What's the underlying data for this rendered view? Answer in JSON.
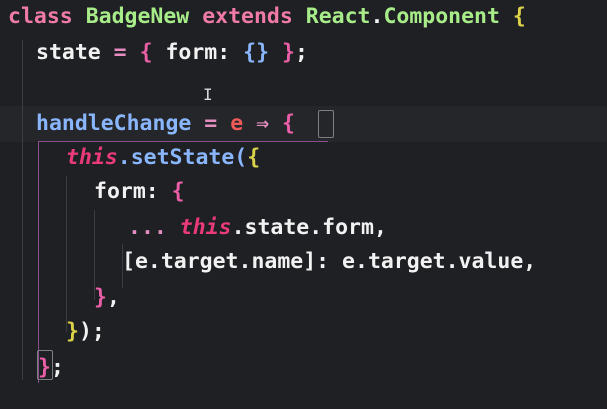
{
  "editor": {
    "lines": [
      {
        "tokens": [
          "class",
          " ",
          "BadgeNew",
          " ",
          "extends",
          " ",
          "React",
          ".",
          "Component",
          " ",
          "{"
        ]
      },
      {
        "tokens": [
          "state",
          " = ",
          "{",
          " form: ",
          "{}",
          " ",
          "}",
          ";"
        ]
      },
      {
        "tokens": []
      },
      {
        "tokens": [
          "handleChange",
          " = ",
          "e",
          " ",
          "⇒",
          " ",
          "{"
        ]
      },
      {
        "tokens": [
          "this",
          ".setState(",
          "{"
        ]
      },
      {
        "tokens": [
          "form: ",
          "{"
        ]
      },
      {
        "tokens": [
          "... ",
          "this",
          ".state.form,"
        ]
      },
      {
        "tokens": [
          "[e.target.name]: e.target.value,"
        ]
      },
      {
        "tokens": [
          "}",
          ","
        ]
      },
      {
        "tokens": [
          "}",
          ");"
        ]
      },
      {
        "tokens": [
          "}",
          ";"
        ]
      }
    ]
  }
}
